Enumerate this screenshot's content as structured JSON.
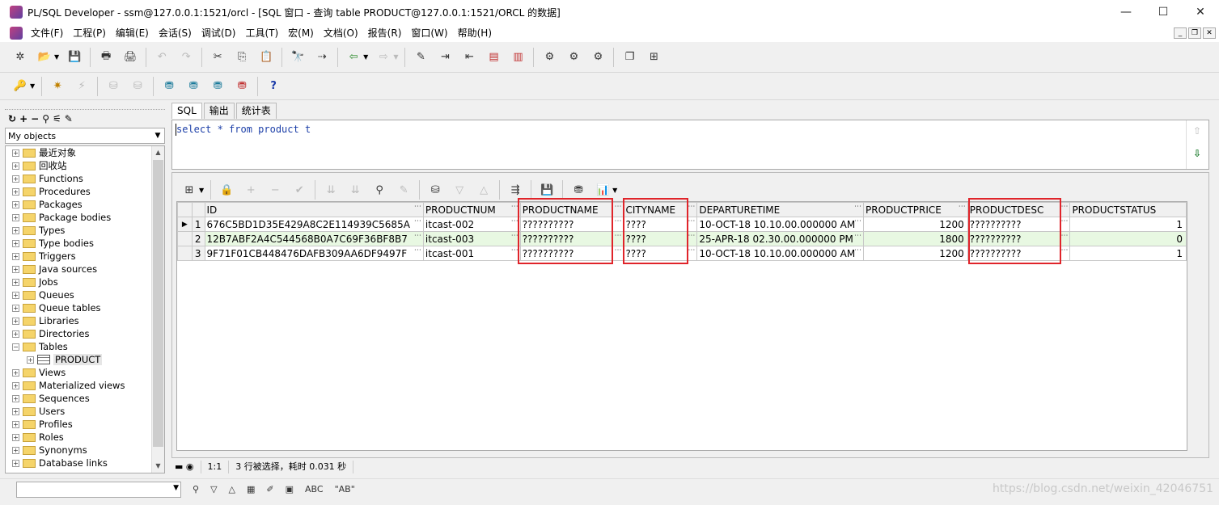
{
  "window": {
    "title": "PL/SQL Developer - ssm@127.0.0.1:1521/orcl - [SQL 窗口 - 查询 table PRODUCT@127.0.0.1:1521/ORCL 的数据]",
    "minimize": "—",
    "maximize": "☐",
    "close": "✕"
  },
  "menu": [
    "文件(F)",
    "工程(P)",
    "编辑(E)",
    "会话(S)",
    "调试(D)",
    "工具(T)",
    "宏(M)",
    "文档(O)",
    "报告(R)",
    "窗口(W)",
    "帮助(H)"
  ],
  "left_panel": {
    "objects_selector": "My objects",
    "tree": [
      {
        "label": "最近对象",
        "expander": "+"
      },
      {
        "label": "回收站",
        "expander": "+"
      },
      {
        "label": "Functions",
        "expander": "+"
      },
      {
        "label": "Procedures",
        "expander": "+"
      },
      {
        "label": "Packages",
        "expander": "+"
      },
      {
        "label": "Package bodies",
        "expander": "+"
      },
      {
        "label": "Types",
        "expander": "+"
      },
      {
        "label": "Type bodies",
        "expander": "+"
      },
      {
        "label": "Triggers",
        "expander": "+"
      },
      {
        "label": "Java sources",
        "expander": "+"
      },
      {
        "label": "Jobs",
        "expander": "+"
      },
      {
        "label": "Queues",
        "expander": "+"
      },
      {
        "label": "Queue tables",
        "expander": "+"
      },
      {
        "label": "Libraries",
        "expander": "+"
      },
      {
        "label": "Directories",
        "expander": "+"
      },
      {
        "label": "Tables",
        "expander": "−"
      },
      {
        "label": "PRODUCT",
        "expander": "+",
        "child": true
      },
      {
        "label": "Views",
        "expander": "+"
      },
      {
        "label": "Materialized views",
        "expander": "+"
      },
      {
        "label": "Sequences",
        "expander": "+"
      },
      {
        "label": "Users",
        "expander": "+"
      },
      {
        "label": "Profiles",
        "expander": "+"
      },
      {
        "label": "Roles",
        "expander": "+"
      },
      {
        "label": "Synonyms",
        "expander": "+"
      },
      {
        "label": "Database links",
        "expander": "+"
      }
    ]
  },
  "editor": {
    "tabs": [
      "SQL",
      "输出",
      "统计表"
    ],
    "sql": "select * from product t"
  },
  "results": {
    "columns": [
      "ID",
      "PRODUCTNUM",
      "PRODUCTNAME",
      "CITYNAME",
      "DEPARTURETIME",
      "PRODUCTPRICE",
      "PRODUCTDESC",
      "PRODUCTSTATUS"
    ],
    "rows": [
      {
        "n": "1",
        "ID": "676C5BD1D35E429A8C2E114939C5685A",
        "PRODUCTNUM": "itcast-002",
        "PRODUCTNAME": "??????????",
        "CITYNAME": "????",
        "DEPARTURETIME": "10-OCT-18 10.10.00.000000 AM",
        "PRODUCTPRICE": "1200",
        "PRODUCTDESC": "??????????",
        "PRODUCTSTATUS": "1"
      },
      {
        "n": "2",
        "ID": "12B7ABF2A4C544568B0A7C69F36BF8B7",
        "PRODUCTNUM": "itcast-003",
        "PRODUCTNAME": "??????????",
        "CITYNAME": "????",
        "DEPARTURETIME": "25-APR-18 02.30.00.000000 PM",
        "PRODUCTPRICE": "1800",
        "PRODUCTDESC": "??????????",
        "PRODUCTSTATUS": "0"
      },
      {
        "n": "3",
        "ID": "9F71F01CB448476DAFB309AA6DF9497F",
        "PRODUCTNUM": "itcast-001",
        "PRODUCTNAME": "??????????",
        "CITYNAME": "????",
        "DEPARTURETIME": "10-OCT-18 10.10.00.000000 AM",
        "PRODUCTPRICE": "1200",
        "PRODUCTDESC": "??????????",
        "PRODUCTSTATUS": "1"
      }
    ],
    "highlight_color": "#e0242a"
  },
  "status": {
    "position": "1:1",
    "message": "3 行被选择，耗时 0.031 秒"
  },
  "find_bar": {
    "abc": "ABC",
    "ab_quoted": "\"AB\""
  },
  "watermark": "https://blog.csdn.net/weixin_42046751"
}
